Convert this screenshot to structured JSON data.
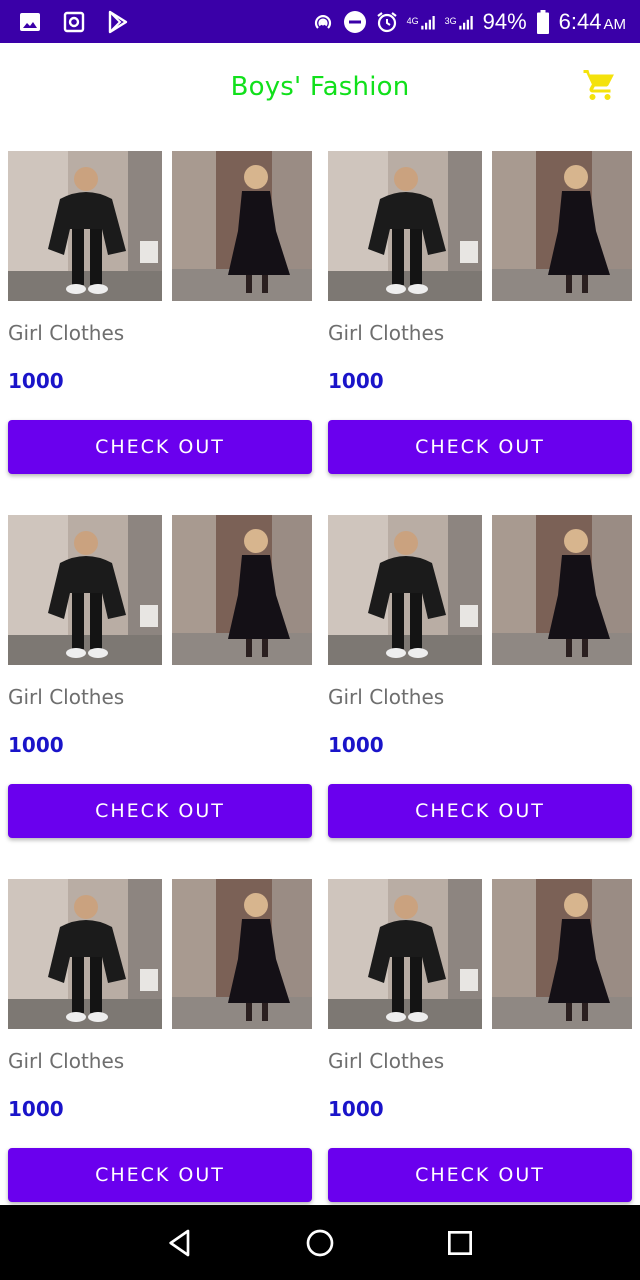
{
  "status_bar": {
    "battery": "94%",
    "time": "6:44",
    "ampm": "AM",
    "net1": "4G",
    "net2": "3G",
    "icons": [
      "image-icon",
      "camera-icon",
      "play-store-icon",
      "hotspot-icon",
      "dnd-icon",
      "alarm-icon",
      "signal-icon",
      "battery-icon"
    ]
  },
  "app_bar": {
    "title": "Boys' Fashion",
    "title_color": "#11e01b",
    "cart_icon": "cart-icon",
    "cart_color": "#f4e20c"
  },
  "products": [
    {
      "name": "Girl Clothes",
      "price": "1000",
      "button": "CHECK OUT"
    },
    {
      "name": "Girl Clothes",
      "price": "1000",
      "button": "CHECK OUT"
    },
    {
      "name": "Girl Clothes",
      "price": "1000",
      "button": "CHECK OUT"
    },
    {
      "name": "Girl Clothes",
      "price": "1000",
      "button": "CHECK OUT"
    },
    {
      "name": "Girl Clothes",
      "price": "1000",
      "button": "CHECK OUT"
    },
    {
      "name": "Girl Clothes",
      "price": "1000",
      "button": "CHECK OUT"
    }
  ],
  "colors": {
    "status_bar": "#3a00a8",
    "button": "#6a00ee",
    "price": "#1a14c9",
    "name": "#6e6e6e"
  },
  "nav_bar": {
    "icons": [
      "back-icon",
      "home-icon",
      "recents-icon"
    ]
  }
}
